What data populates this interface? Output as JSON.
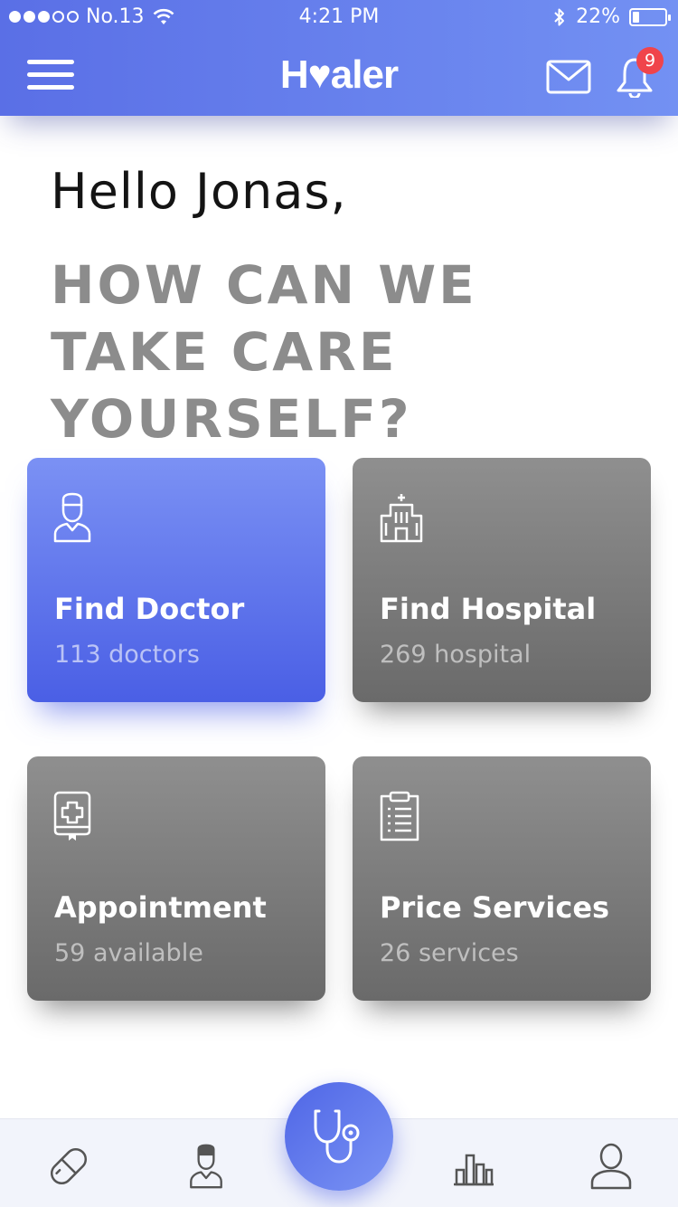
{
  "status_bar": {
    "carrier": "No.13",
    "time": "4:21 PM",
    "battery": "22%",
    "battery_level": 0.22,
    "signal_bars_filled": 3,
    "signal_bars_total": 5
  },
  "header": {
    "logo": "H♥aler",
    "notification_count": "9",
    "icons": [
      "menu-icon",
      "mail-icon",
      "bell-icon"
    ]
  },
  "greeting": "Hello Jonas,",
  "headline": "HOW CAN WE TAKE CARE YOURSELF?",
  "cards": [
    {
      "title": "Find Doctor",
      "subtitle": "113 doctors",
      "icon": "doctor-icon"
    },
    {
      "title": "Find Hospital",
      "subtitle": "269 hospital",
      "icon": "hospital-icon"
    },
    {
      "title": "Appointment",
      "subtitle": "59 available",
      "icon": "appointment-icon"
    },
    {
      "title": "Price Services",
      "subtitle": "26 services",
      "icon": "clipboard-icon"
    }
  ],
  "bottom_nav": {
    "items": [
      "pill-icon",
      "doctor-icon",
      "stethoscope-icon",
      "chart-icon",
      "profile-icon"
    ]
  },
  "colors": {
    "primary": "#5a6fe6",
    "primary_light": "#7b91f4",
    "card_gray": "#7d7d7d",
    "badge": "#f0444b",
    "headline_gray": "#8c8c8c"
  }
}
